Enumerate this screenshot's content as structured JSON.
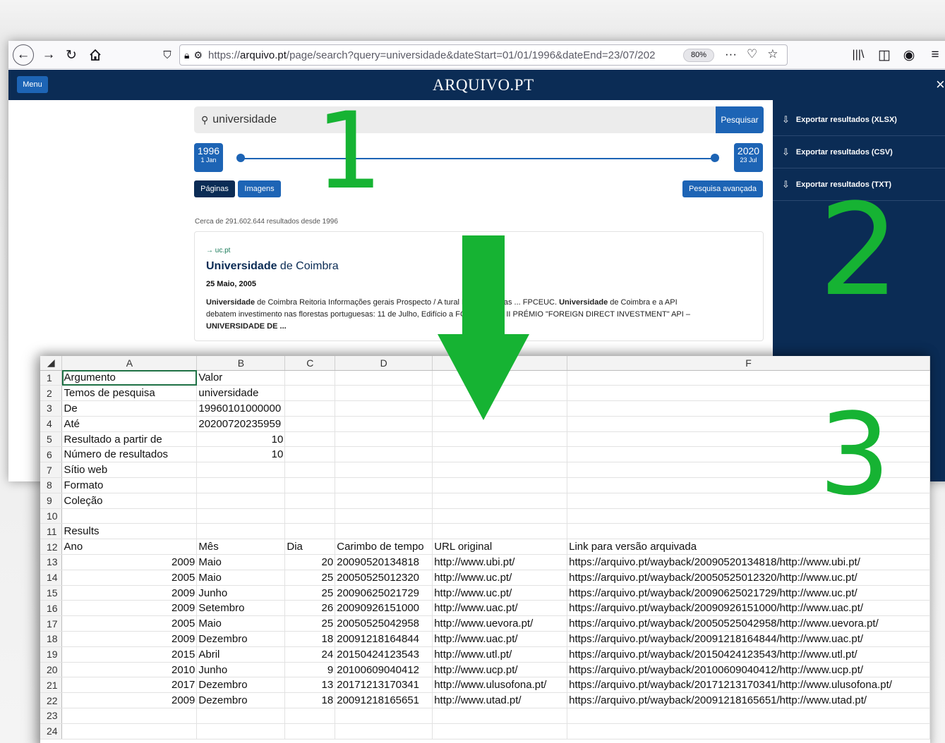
{
  "browser": {
    "url_prefix": "https://",
    "url_domain": "arquivo.pt",
    "url_path": "/page/search?query=universidade&dateStart=01/01/1996&dateEnd=23/07/202",
    "zoom": "80%"
  },
  "site": {
    "menu_label": "Menu",
    "logo": "ARQUIVO.PT",
    "close": "×"
  },
  "search": {
    "query": "universidade",
    "button": "Pesquisar",
    "start_year": "1996",
    "start_day": "1",
    "start_month": "Jan",
    "end_year": "2020",
    "end_day": "23",
    "end_month": "Jul",
    "tab_pages": "Páginas",
    "tab_images": "Imagens",
    "advanced": "Pesquisa avançada"
  },
  "results": {
    "count_text": "Cerca de 291.602.644 resultados desde 1996",
    "first": {
      "domain": "→ uc.pt",
      "title_bold": "Universidade",
      "title_rest": " de Coimbra",
      "date": "25 Maio, 2005",
      "snippet_l1_bold": "Universidade",
      "snippet_l1": " de Coimbra     Reitoria Informações gerais Prospecto / A         tural Eventos Listas ... FPCEUC. ",
      "snippet_l1_bold2": "Universidade",
      "snippet_l1_end": " de Coimbra e a API",
      "snippet_l2": "debatem investimento nas florestas portuguesas: 11 de Julho, Edifício            a FCTUC - Pólo II    PRÉMIO \"FOREIGN DIRECT INVESTMENT\" API –",
      "snippet_l3": "UNIVERSIDADE DE ..."
    }
  },
  "sidebar": {
    "export_xlsx": "Exportar resultados (XLSX)",
    "export_csv": "Exportar resultados (CSV)",
    "export_txt": "Exportar resultados (TXT)"
  },
  "annotations": {
    "one": "1",
    "two": "2",
    "three": "3",
    "color": "#16b333"
  },
  "spreadsheet": {
    "columns": [
      "A",
      "B",
      "C",
      "D",
      "",
      "F"
    ],
    "rows": [
      [
        "Argumento",
        "Valor",
        "",
        "",
        "",
        ""
      ],
      [
        "Temos de pesquisa",
        "universidade",
        "",
        "",
        "",
        ""
      ],
      [
        "De",
        "19960101000000",
        "",
        "",
        "",
        ""
      ],
      [
        "Até",
        "20200720235959",
        "",
        "",
        "",
        ""
      ],
      [
        "Resultado a partir de",
        "10",
        "",
        "",
        "",
        ""
      ],
      [
        "Número de resultados",
        "10",
        "",
        "",
        "",
        ""
      ],
      [
        "Sítio web",
        "",
        "",
        "",
        "",
        ""
      ],
      [
        "Formato",
        "",
        "",
        "",
        "",
        ""
      ],
      [
        "Coleção",
        "",
        "",
        "",
        "",
        ""
      ],
      [
        "",
        "",
        "",
        "",
        "",
        ""
      ],
      [
        "Results",
        "",
        "",
        "",
        "",
        ""
      ],
      [
        "Ano",
        "Mês",
        "Dia",
        "Carimbo de tempo",
        "URL original",
        "Link para versão arquivada"
      ],
      [
        "2009",
        "Maio",
        "20",
        "20090520134818",
        "http://www.ubi.pt/",
        "https://arquivo.pt/wayback/20090520134818/http://www.ubi.pt/"
      ],
      [
        "2005",
        "Maio",
        "25",
        "20050525012320",
        "http://www.uc.pt/",
        "https://arquivo.pt/wayback/20050525012320/http://www.uc.pt/"
      ],
      [
        "2009",
        "Junho",
        "25",
        "20090625021729",
        "http://www.uc.pt/",
        "https://arquivo.pt/wayback/20090625021729/http://www.uc.pt/"
      ],
      [
        "2009",
        "Setembro",
        "26",
        "20090926151000",
        "http://www.uac.pt/",
        "https://arquivo.pt/wayback/20090926151000/http://www.uac.pt/"
      ],
      [
        "2005",
        "Maio",
        "25",
        "20050525042958",
        "http://www.uevora.pt/",
        "https://arquivo.pt/wayback/20050525042958/http://www.uevora.pt/"
      ],
      [
        "2009",
        "Dezembro",
        "18",
        "20091218164844",
        "http://www.uac.pt/",
        "https://arquivo.pt/wayback/20091218164844/http://www.uac.pt/"
      ],
      [
        "2015",
        "Abril",
        "24",
        "20150424123543",
        "http://www.utl.pt/",
        "https://arquivo.pt/wayback/20150424123543/http://www.utl.pt/"
      ],
      [
        "2010",
        "Junho",
        "9",
        "20100609040412",
        "http://www.ucp.pt/",
        "https://arquivo.pt/wayback/20100609040412/http://www.ucp.pt/"
      ],
      [
        "2017",
        "Dezembro",
        "13",
        "20171213170341",
        "http://www.ulusofona.pt/",
        "https://arquivo.pt/wayback/20171213170341/http://www.ulusofona.pt/"
      ],
      [
        "2009",
        "Dezembro",
        "18",
        "20091218165651",
        "http://www.utad.pt/",
        "https://arquivo.pt/wayback/20091218165651/http://www.utad.pt/"
      ],
      [
        "",
        "",
        "",
        "",
        "",
        ""
      ],
      [
        "",
        "",
        "",
        "",
        "",
        ""
      ]
    ]
  }
}
